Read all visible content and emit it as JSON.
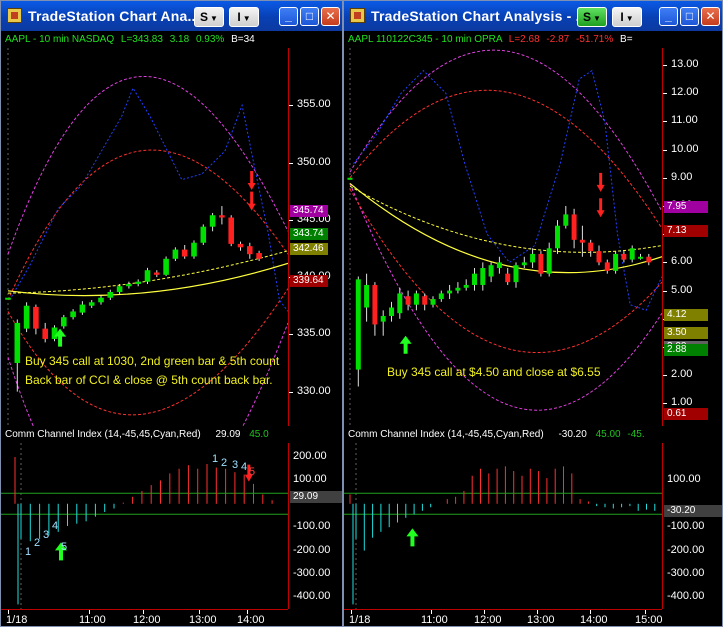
{
  "colors": {
    "up": "#00e000",
    "down": "#ff2020",
    "band_outer": "#e040e0",
    "band_inner": "#ff3030",
    "signal_blue": "#2040ff",
    "ma": "#ffff40",
    "cci_pos": "#ff3030",
    "cci_neg": "#20e0e0",
    "arrow_green": "#20ff20",
    "arrow_red": "#ff2020",
    "title_blue": "#0840b4"
  },
  "left": {
    "title": "TradeStation Chart Ana...",
    "btn_s": "S",
    "btn_i": "I",
    "header": {
      "symbol": "AAPL - 10 min  NASDAQ",
      "last": "L=343.83",
      "chg": "3.18",
      "pct": "0.93%",
      "extra": "B=34"
    },
    "price_ticks": [
      "355.00",
      "350.00",
      "345.00",
      "340.00",
      "335.00",
      "330.00"
    ],
    "price_labels": [
      {
        "text": "345.74",
        "color": "#a000a0"
      },
      {
        "text": "343.74",
        "color": "#008000"
      },
      {
        "text": "342.46",
        "color": "#808000"
      },
      {
        "text": "339.64",
        "color": "#a00000"
      }
    ],
    "note1": "Buy 345 call at 1030, 2nd green bar & 5th count",
    "note2": "Back bar of CCI & close @ 5th count back bar.",
    "cci_header": "Comm Channel Index (14,-45,45,Cyan,Red)",
    "cci_value": "29.09",
    "cci_value2": "45.0",
    "cci_ticks": [
      "200.00",
      "100.00",
      "-100.00",
      "-200.00",
      "-300.00",
      "-400.00"
    ],
    "cci_label": "29.09",
    "counts_up": [
      "1",
      "2",
      "3",
      "4",
      "5"
    ],
    "counts_down": [
      "1",
      "2",
      "3",
      "4",
      "5"
    ],
    "x_ticks": [
      "1/18",
      "11:00",
      "12:00",
      "13:00",
      "14:00"
    ],
    "chart_data": {
      "type": "candlestick",
      "ylim": [
        327,
        360
      ],
      "candles": [
        [
          338.2,
          338.2,
          338.2,
          338.2
        ],
        [
          332.5,
          336.0,
          330.0,
          336.3
        ],
        [
          335.5,
          337.5,
          335.2,
          337.8
        ],
        [
          337.4,
          335.5,
          335.0,
          337.6
        ],
        [
          335.5,
          334.6,
          334.3,
          336.0
        ],
        [
          334.6,
          335.6,
          334.4,
          335.8
        ],
        [
          335.7,
          336.5,
          335.5,
          336.7
        ],
        [
          336.5,
          337.0,
          336.3,
          337.2
        ],
        [
          336.9,
          337.6,
          336.7,
          337.9
        ],
        [
          337.5,
          337.8,
          337.3,
          338.0
        ],
        [
          337.8,
          338.2,
          337.6,
          338.4
        ],
        [
          338.2,
          338.7,
          338.0,
          338.9
        ],
        [
          338.7,
          339.2,
          338.5,
          339.4
        ],
        [
          339.2,
          339.4,
          339.0,
          339.6
        ],
        [
          339.4,
          339.6,
          339.2,
          339.8
        ],
        [
          339.6,
          340.6,
          339.4,
          340.8
        ],
        [
          340.4,
          340.2,
          340.0,
          340.6
        ],
        [
          340.2,
          341.6,
          340.1,
          341.8
        ],
        [
          341.6,
          342.4,
          341.4,
          342.6
        ],
        [
          342.4,
          341.8,
          341.6,
          342.8
        ],
        [
          341.8,
          343.0,
          341.6,
          343.2
        ],
        [
          343.0,
          344.4,
          342.8,
          344.6
        ],
        [
          344.4,
          345.4,
          344.0,
          345.6
        ],
        [
          345.4,
          345.2,
          344.6,
          346.2
        ],
        [
          345.2,
          342.9,
          342.7,
          345.4
        ],
        [
          342.9,
          342.6,
          342.3,
          343.1
        ],
        [
          342.7,
          342.0,
          341.6,
          343.0
        ],
        [
          342.1,
          341.6,
          341.4,
          342.3
        ]
      ],
      "cci": [
        -150,
        -160,
        -150,
        -135,
        -120,
        -95,
        -85,
        -75,
        -55,
        -35,
        -20,
        5,
        30,
        55,
        80,
        100,
        130,
        150,
        165,
        150,
        170,
        155,
        150,
        135,
        125,
        85,
        40,
        15
      ]
    }
  },
  "right": {
    "title": "TradeStation Chart Analysis - ...",
    "btn_s": "S",
    "btn_i": "I",
    "header": {
      "symbol": "AAPL 110122C345 - 10 min  OPRA",
      "last": "L=2.68",
      "chg": "-2.87",
      "pct": "-51.71%",
      "extra": "B="
    },
    "price_ticks": [
      "13.00",
      "12.00",
      "11.00",
      "10.00",
      "9.00",
      "8.00",
      "7.00",
      "6.00",
      "5.00",
      "4.00",
      "3.00",
      "2.00",
      "1.00"
    ],
    "price_labels": [
      {
        "text": "7.95",
        "color": "#a000a0"
      },
      {
        "text": "7.13",
        "color": "#a00000"
      },
      {
        "text": "4.12",
        "color": "#808000"
      },
      {
        "text": "3.50",
        "color": "#808000"
      },
      {
        "text": "3.00",
        "color": "#606060"
      },
      {
        "text": "2.88",
        "color": "#008000"
      },
      {
        "text": "0.61",
        "color": "#a00000"
      }
    ],
    "note": "Buy 345 call at $4.50 and close at $6.55",
    "cci_header": "Comm Channel Index (14,-45,45,Cyan,Red)",
    "cci_value": "-30.20",
    "cci_value2": "45.00",
    "cci_value3": "-45.",
    "cci_ticks": [
      "100.00",
      "-100.00",
      "-200.00",
      "-300.00",
      "-400.00"
    ],
    "cci_label": "-30.20",
    "x_ticks": [
      "1/18",
      "11:00",
      "12:00",
      "13:00",
      "14:00",
      "15:00"
    ],
    "chart_data": {
      "type": "candlestick",
      "ylim": [
        0.2,
        13.6
      ],
      "candles": [
        [
          9.0,
          9.0,
          9.0,
          9.0
        ],
        [
          2.2,
          5.4,
          1.6,
          5.5
        ],
        [
          4.4,
          5.2,
          3.9,
          5.6
        ],
        [
          5.2,
          3.8,
          3.4,
          5.3
        ],
        [
          3.9,
          4.1,
          3.4,
          4.3
        ],
        [
          4.1,
          4.4,
          3.9,
          4.6
        ],
        [
          4.2,
          4.9,
          4.0,
          5.1
        ],
        [
          4.8,
          4.5,
          4.3,
          5.0
        ],
        [
          4.5,
          4.9,
          4.3,
          5.0
        ],
        [
          4.8,
          4.5,
          4.3,
          4.9
        ],
        [
          4.5,
          4.7,
          4.4,
          4.8
        ],
        [
          4.7,
          4.9,
          4.6,
          5.0
        ],
        [
          4.9,
          5.0,
          4.7,
          5.2
        ],
        [
          5.0,
          5.1,
          4.9,
          5.3
        ],
        [
          5.1,
          5.2,
          5.0,
          5.4
        ],
        [
          5.2,
          5.6,
          5.0,
          5.8
        ],
        [
          5.2,
          5.8,
          5.0,
          6.0
        ],
        [
          5.5,
          5.9,
          5.3,
          6.0
        ],
        [
          5.8,
          6.0,
          5.6,
          6.2
        ],
        [
          5.6,
          5.3,
          5.2,
          5.8
        ],
        [
          5.3,
          5.9,
          5.1,
          6.0
        ],
        [
          5.9,
          6.0,
          5.8,
          6.2
        ],
        [
          6.0,
          6.3,
          5.8,
          6.5
        ],
        [
          6.3,
          5.6,
          5.5,
          6.4
        ],
        [
          5.6,
          6.5,
          5.5,
          6.7
        ],
        [
          6.5,
          7.3,
          6.3,
          7.5
        ],
        [
          7.3,
          7.7,
          7.2,
          8.0
        ],
        [
          7.7,
          6.8,
          6.5,
          7.9
        ],
        [
          6.8,
          6.7,
          6.2,
          7.3
        ],
        [
          6.7,
          6.4,
          6.2,
          6.8
        ],
        [
          6.4,
          6.0,
          5.9,
          6.6
        ],
        [
          6.0,
          5.7,
          5.6,
          6.1
        ],
        [
          5.7,
          6.3,
          5.6,
          6.4
        ],
        [
          6.3,
          6.1,
          6.0,
          6.4
        ],
        [
          6.1,
          6.5,
          6.0,
          6.6
        ],
        [
          6.2,
          6.2,
          6.1,
          6.3
        ],
        [
          6.2,
          6.0,
          5.9,
          6.3
        ]
      ],
      "cci": [
        -150,
        -200,
        -145,
        -120,
        -100,
        -80,
        -60,
        -45,
        -30,
        -15,
        0,
        20,
        30,
        55,
        120,
        150,
        130,
        150,
        160,
        140,
        120,
        150,
        140,
        110,
        150,
        160,
        130,
        20,
        10,
        -10,
        -15,
        -20,
        -15,
        -10,
        -30,
        -25,
        -30
      ]
    }
  }
}
